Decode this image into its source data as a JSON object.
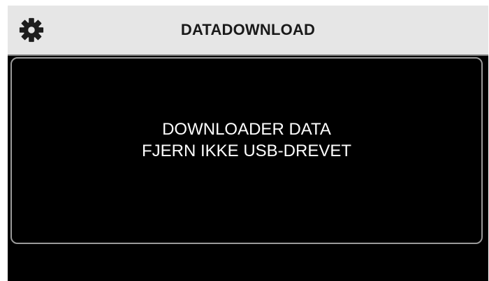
{
  "header": {
    "title": "DATADOWNLOAD",
    "settings_icon": "gear-icon"
  },
  "message": {
    "line1": "DOWNLOADER DATA",
    "line2": "FJERN IKKE USB-DREVET"
  },
  "colors": {
    "header_background": "#e6e6e6",
    "screen_background": "#000000",
    "panel_border": "#9a9a9a",
    "text": "#ffffff",
    "title_text": "#1a1a1a"
  }
}
